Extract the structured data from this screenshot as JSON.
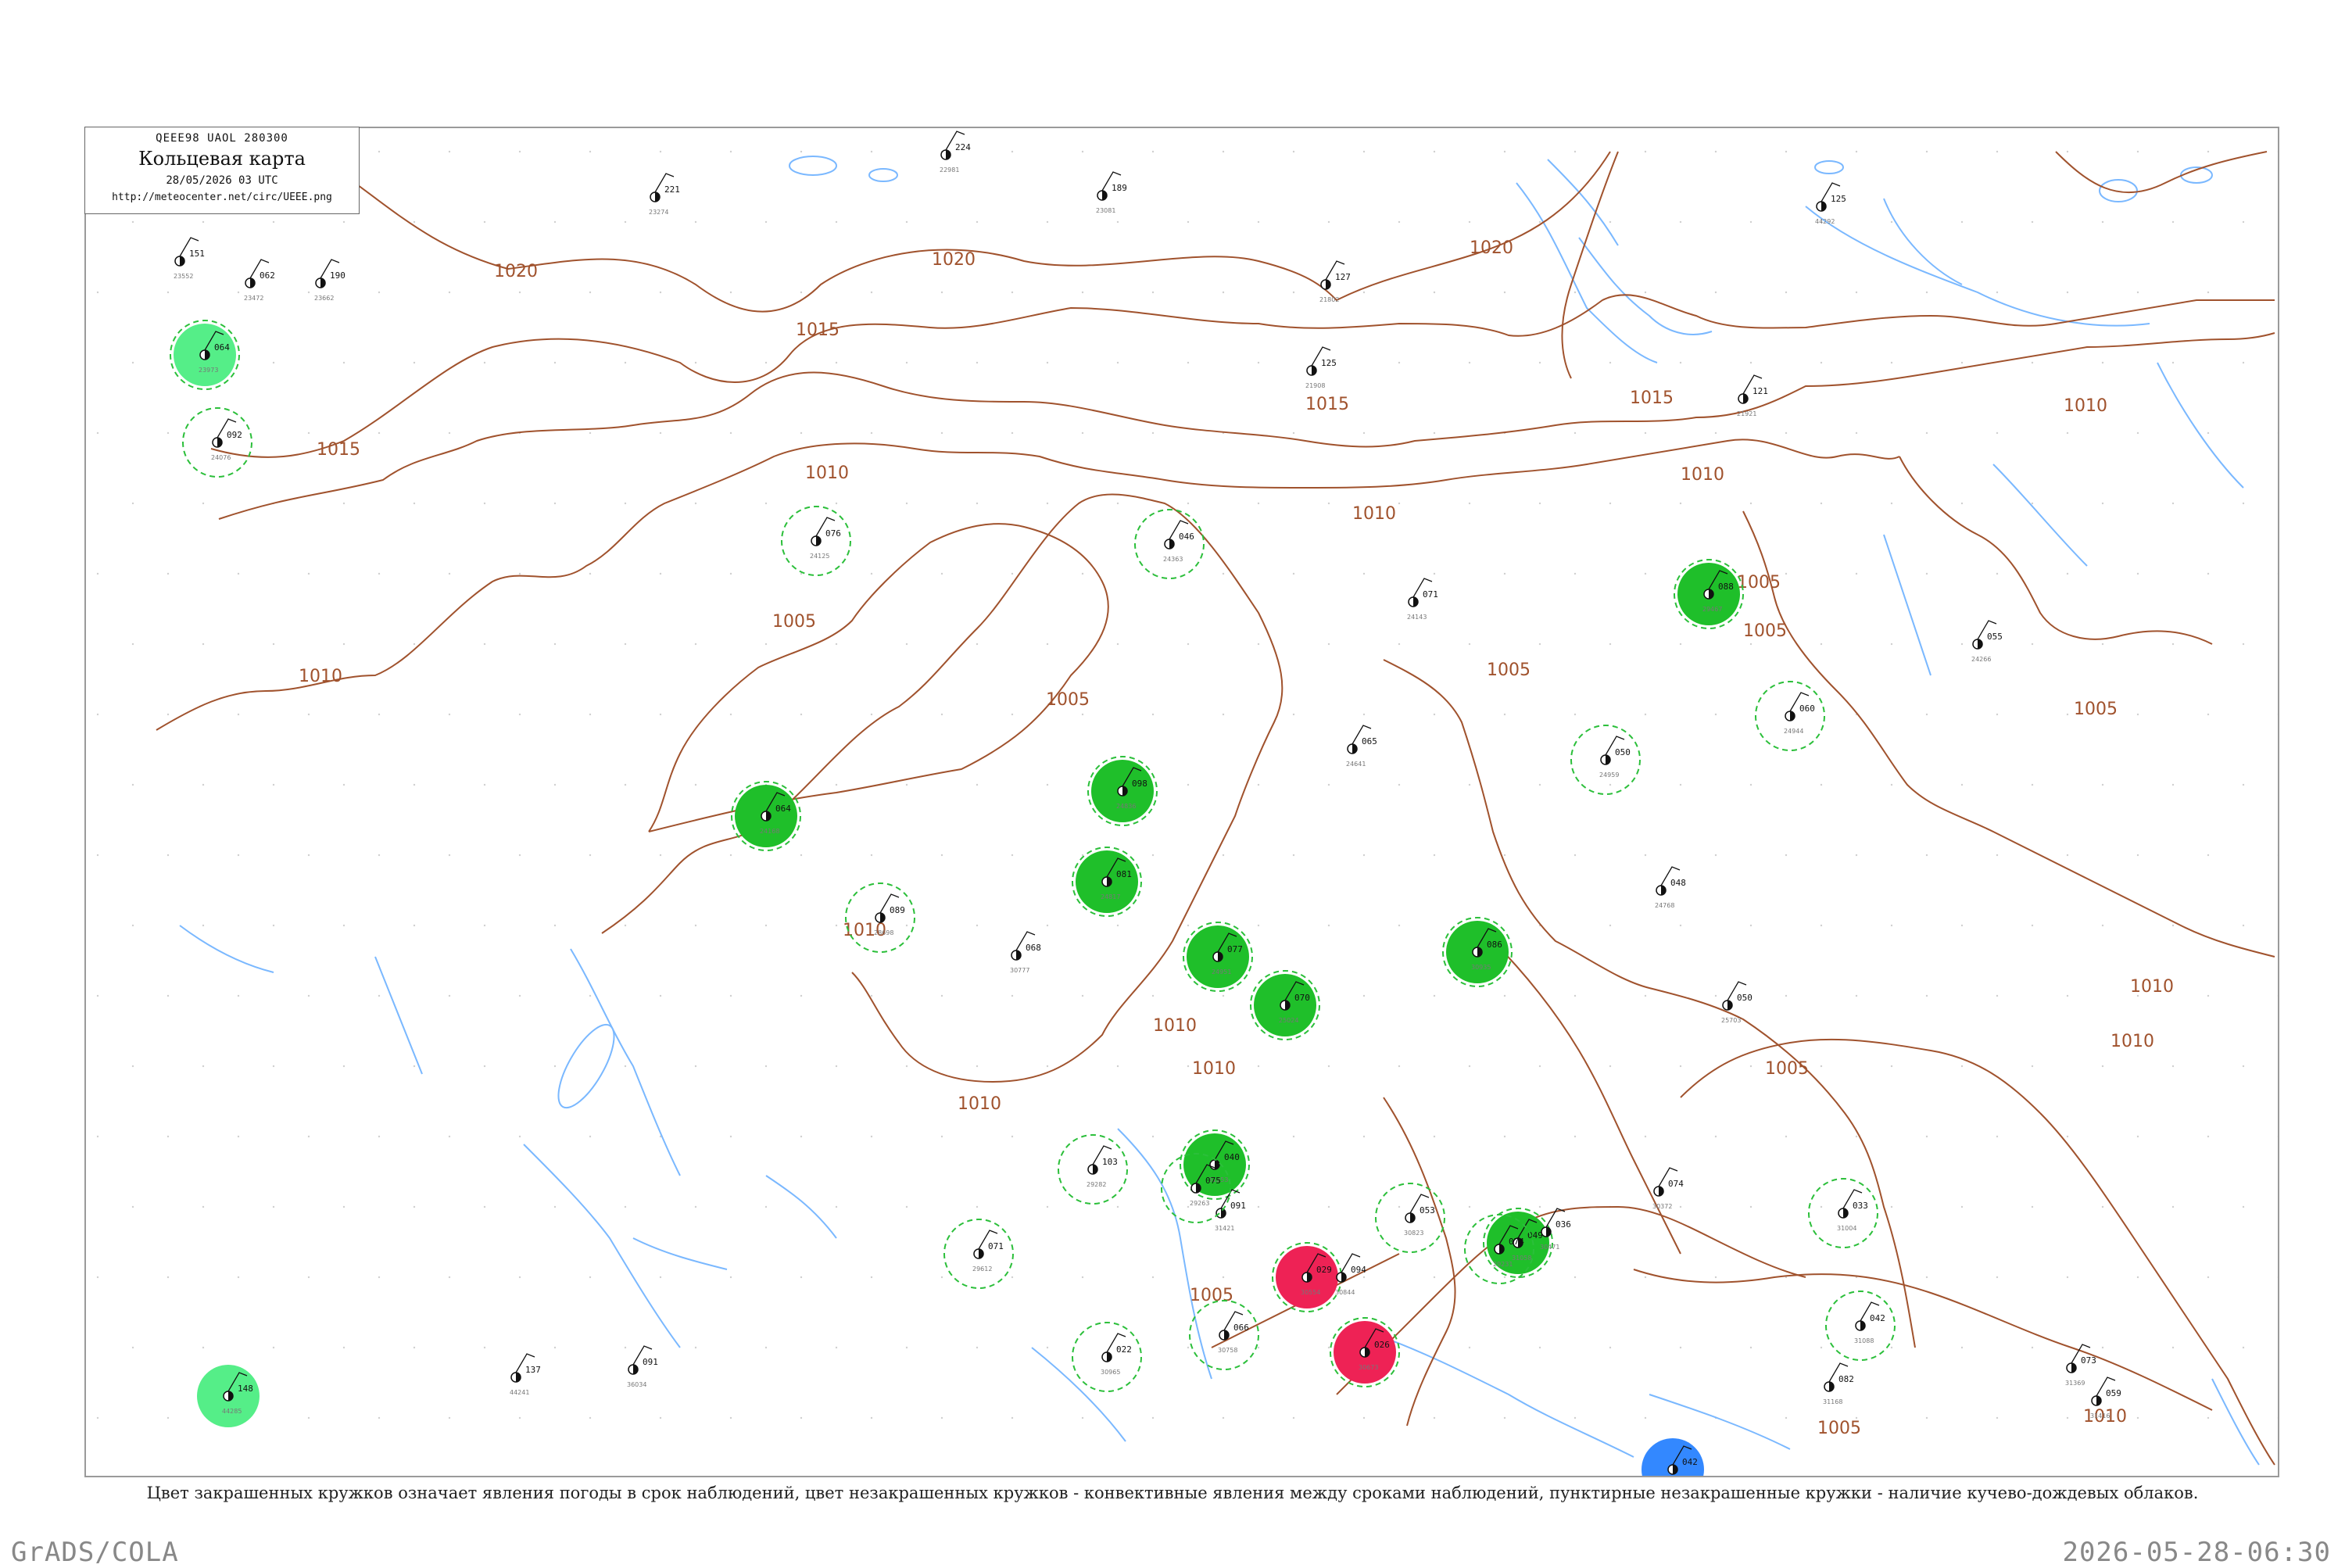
{
  "header": {
    "code": "QEEE98  UAOL  280300",
    "title": "Кольцевая карта",
    "datetime": "28/05/2026 03 UTC",
    "url": "http://meteocenter.net/circ/UEEE.png"
  },
  "caption": "Цвет закрашенных кружков означает явления погоды в срок наблюдений, цвет незакрашенных кружков - конвективные явления между сроками наблюдений, пунктирные незакрашенные кружки - наличие кучево-дождевых облаков.",
  "footer": {
    "left": "GrADS/COLA",
    "right": "2026-05-28-06:30"
  },
  "colors": {
    "isobar": "#a0522d",
    "water": "#7ab8ff",
    "rain_fill": "#1fbf2a",
    "light_rain_fill": "#55ee88",
    "thunder_fill": "#ee2255",
    "snow_fill": "#3388ff",
    "cb_dashed": "#2bbf3a"
  },
  "isobar_labels": [
    "1020",
    "1020",
    "1020",
    "1015",
    "1015",
    "1015",
    "1015",
    "1010",
    "1010",
    "1010",
    "1010",
    "1010",
    "1010",
    "1010",
    "1010",
    "1005",
    "1005",
    "1005",
    "1005",
    "1005",
    "1005",
    "1005",
    "1010",
    "1010",
    "1005",
    "1010",
    "1010",
    "1005"
  ],
  "stations": [
    {
      "id": "23552",
      "val": "151",
      "w": "",
      "fill": "",
      "cb": false
    },
    {
      "id": "23662",
      "val": "190",
      "w": "",
      "fill": "",
      "cb": false
    },
    {
      "id": "23472",
      "val": "062",
      "w": "",
      "fill": "",
      "cb": false
    },
    {
      "id": "23274",
      "val": "221",
      "w": "",
      "fill": "",
      "cb": false
    },
    {
      "id": "22981",
      "val": "224",
      "w": "",
      "fill": "",
      "cb": false
    },
    {
      "id": "23081",
      "val": "189",
      "w": "",
      "fill": "",
      "cb": false
    },
    {
      "id": "23973",
      "val": "064",
      "w": "",
      "fill": "light",
      "cb": true
    },
    {
      "id": "24076",
      "val": "092",
      "w": "",
      "fill": "",
      "cb": true
    },
    {
      "id": "24168",
      "val": "064",
      "w": "",
      "fill": "rain",
      "cb": true
    },
    {
      "id": "24836",
      "val": "098",
      "w": "",
      "fill": "rain",
      "cb": true
    },
    {
      "id": "24817",
      "val": "081",
      "w": "",
      "fill": "rain",
      "cb": true
    },
    {
      "id": "24951",
      "val": "077",
      "w": "",
      "fill": "rain",
      "cb": true
    },
    {
      "id": "25024",
      "val": "070",
      "w": "",
      "fill": "rain",
      "cb": true
    },
    {
      "id": "29467",
      "val": "088",
      "w": "",
      "fill": "rain",
      "cb": true
    },
    {
      "id": "30554",
      "val": "029",
      "w": "",
      "fill": "thunder",
      "cb": true
    },
    {
      "id": "30673",
      "val": "026",
      "w": "",
      "fill": "thunder",
      "cb": true
    },
    {
      "id": "30935",
      "val": "086",
      "w": "",
      "fill": "rain",
      "cb": true
    },
    {
      "id": "31058",
      "val": "049",
      "w": "",
      "fill": "rain",
      "cb": true
    },
    {
      "id": "31253",
      "val": "040",
      "w": "",
      "fill": "rain",
      "cb": true
    },
    {
      "id": "31612",
      "val": "042",
      "w": "",
      "fill": "snow",
      "cb": false
    },
    {
      "id": "44285",
      "val": "148",
      "w": "",
      "fill": "light",
      "cb": false
    },
    {
      "id": "24125",
      "val": "076",
      "w": "",
      "fill": "",
      "cb": true
    },
    {
      "id": "24363",
      "val": "046",
      "w": "",
      "fill": "",
      "cb": true
    },
    {
      "id": "24944",
      "val": "060",
      "w": "",
      "fill": "",
      "cb": true
    },
    {
      "id": "21921",
      "val": "121",
      "w": "",
      "fill": "",
      "cb": false
    },
    {
      "id": "24266",
      "val": "055",
      "w": "",
      "fill": "",
      "cb": false
    },
    {
      "id": "21908",
      "val": "125",
      "w": "",
      "fill": "",
      "cb": false
    },
    {
      "id": "21802",
      "val": "127",
      "w": "",
      "fill": "",
      "cb": false
    },
    {
      "id": "24143",
      "val": "071",
      "w": "",
      "fill": "",
      "cb": false
    },
    {
      "id": "24641",
      "val": "065",
      "w": "",
      "fill": "",
      "cb": false
    },
    {
      "id": "24959",
      "val": "050",
      "w": "",
      "fill": "",
      "cb": true
    },
    {
      "id": "24768",
      "val": "048",
      "w": "",
      "fill": "",
      "cb": false
    },
    {
      "id": "25703",
      "val": "050",
      "w": "",
      "fill": "",
      "cb": false
    },
    {
      "id": "31004",
      "val": "033",
      "w": "",
      "fill": "",
      "cb": true
    },
    {
      "id": "31088",
      "val": "042",
      "w": "",
      "fill": "",
      "cb": true
    },
    {
      "id": "31168",
      "val": "082",
      "w": "",
      "fill": "",
      "cb": false
    },
    {
      "id": "31369",
      "val": "073",
      "w": "",
      "fill": "",
      "cb": false
    },
    {
      "id": "31416",
      "val": "059",
      "w": "",
      "fill": "",
      "cb": false
    },
    {
      "id": "31421",
      "val": "091",
      "w": "",
      "fill": "",
      "cb": false
    },
    {
      "id": "30758",
      "val": "066",
      "w": "",
      "fill": "",
      "cb": true
    },
    {
      "id": "30844",
      "val": "094",
      "w": "",
      "fill": "",
      "cb": false
    },
    {
      "id": "30823",
      "val": "053",
      "w": "",
      "fill": "",
      "cb": true
    },
    {
      "id": "30965",
      "val": "022",
      "w": "",
      "fill": "",
      "cb": true
    },
    {
      "id": "30777",
      "val": "068",
      "w": "",
      "fill": "",
      "cb": false
    },
    {
      "id": "30372",
      "val": "074",
      "w": "",
      "fill": "",
      "cb": false
    },
    {
      "id": "30471",
      "val": "036",
      "w": "",
      "fill": "",
      "cb": false
    },
    {
      "id": "29231",
      "val": "074",
      "w": "",
      "fill": "",
      "cb": true
    },
    {
      "id": "29263",
      "val": "075",
      "w": "",
      "fill": "",
      "cb": true
    },
    {
      "id": "29282",
      "val": "103",
      "w": "",
      "fill": "",
      "cb": true
    },
    {
      "id": "28698",
      "val": "089",
      "w": "",
      "fill": "",
      "cb": true
    },
    {
      "id": "29612",
      "val": "071",
      "w": "",
      "fill": "",
      "cb": true
    },
    {
      "id": "36034",
      "val": "091",
      "w": "",
      "fill": "",
      "cb": false
    },
    {
      "id": "44241",
      "val": "137",
      "w": "",
      "fill": "",
      "cb": false
    },
    {
      "id": "44292",
      "val": "125",
      "w": "",
      "fill": "",
      "cb": false
    }
  ]
}
